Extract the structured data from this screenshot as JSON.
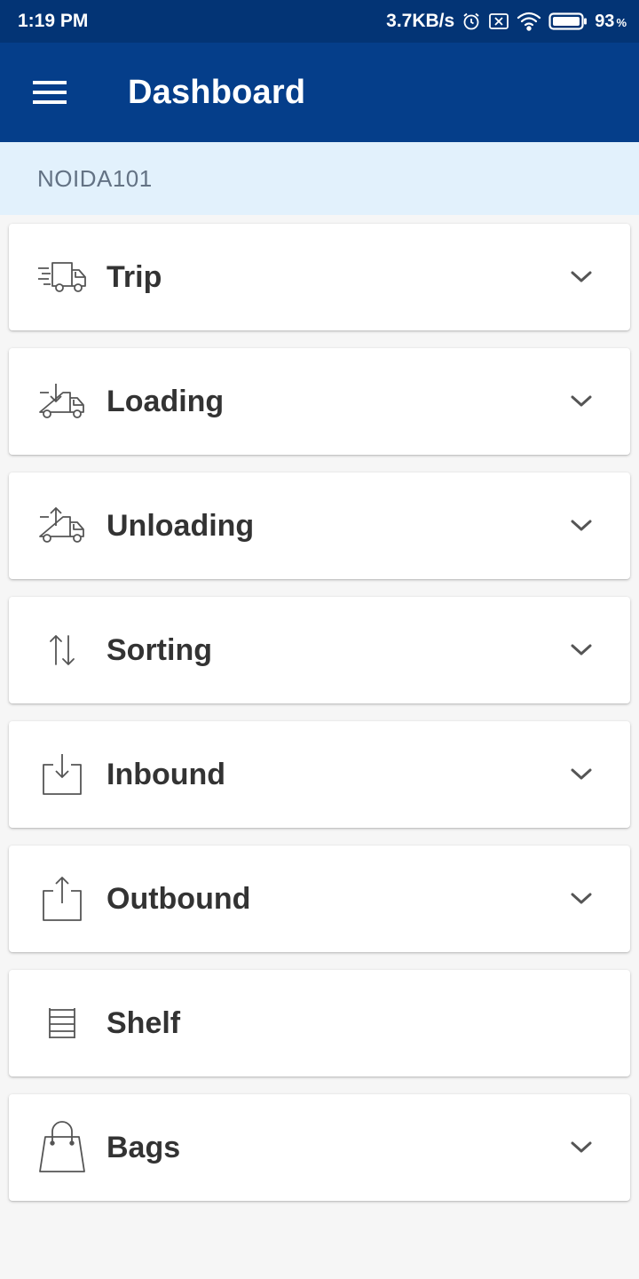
{
  "status_bar": {
    "time": "1:19 PM",
    "net_speed": "3.7KB/s",
    "battery_level": "93",
    "battery_unit": "%",
    "icons": [
      "alarm-icon",
      "sim-off-icon",
      "wifi-icon",
      "battery-icon"
    ]
  },
  "app_bar": {
    "title": "Dashboard",
    "menu_icon": "hamburger-menu-icon"
  },
  "station": {
    "code": "NOIDA101"
  },
  "menu": {
    "items": [
      {
        "label": "Trip",
        "icon": "delivery-truck-icon",
        "expandable": true
      },
      {
        "label": "Loading",
        "icon": "truck-loading-icon",
        "expandable": true
      },
      {
        "label": "Unloading",
        "icon": "truck-unloading-icon",
        "expandable": true
      },
      {
        "label": "Sorting",
        "icon": "sort-arrows-icon",
        "expandable": true
      },
      {
        "label": "Inbound",
        "icon": "inbound-tray-icon",
        "expandable": true
      },
      {
        "label": "Outbound",
        "icon": "outbound-tray-icon",
        "expandable": true
      },
      {
        "label": "Shelf",
        "icon": "shelf-icon",
        "expandable": false
      },
      {
        "label": "Bags",
        "icon": "shopping-bag-icon",
        "expandable": true
      }
    ]
  },
  "colors": {
    "status_bar": "#033475",
    "app_bar": "#053e8a",
    "station_bar": "#e2f1fc",
    "station_text": "#637284",
    "card_text": "#333333",
    "icon_stroke": "#555555"
  }
}
